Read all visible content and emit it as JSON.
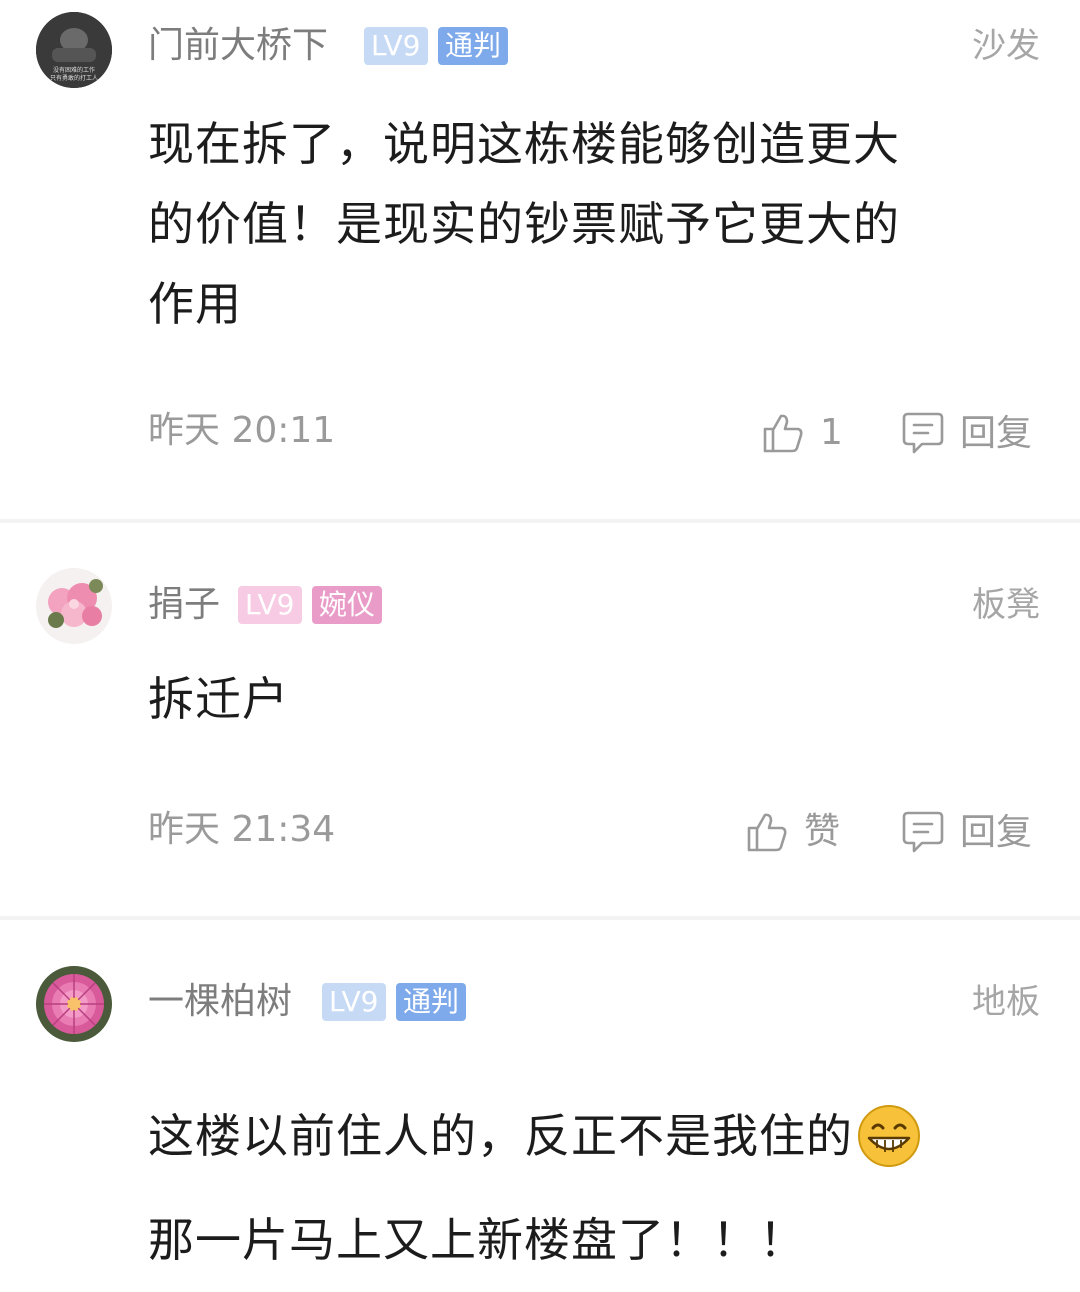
{
  "comments": [
    {
      "username": "门前大桥下",
      "level": "LV9",
      "title": "通判",
      "floor": "沙发",
      "lines": [
        "现在拆了，说明这栋楼能够创造更大",
        "的价值！是现实的钞票赋予它更大的",
        "作用"
      ],
      "time": "昨天 20:11",
      "like_label": "1",
      "reply_label": "回复",
      "avatar_text": [
        "没有困难的工作",
        "只有勇敢的打工人"
      ]
    },
    {
      "username": "捐子",
      "level": "LV9",
      "title": "婉仪",
      "floor": "板凳",
      "lines": [
        "拆迁户"
      ],
      "time": "昨天 21:34",
      "like_label": "赞",
      "reply_label": "回复"
    },
    {
      "username": "一棵柏树",
      "level": "LV9",
      "title": "通判",
      "floor": "地板",
      "lines": [
        "这楼以前住人的，反正不是我住的",
        "那一片马上又上新楼盘了！！！"
      ]
    }
  ],
  "colors": {
    "badge_blue": "#7ea9ea",
    "badge_pink": "#ea9cc8",
    "meta_gray": "#9a9a9a"
  },
  "icons": {
    "like": "thumbs-up-icon",
    "reply": "speech-bubble-icon",
    "emoji": "grinning-face-icon"
  }
}
